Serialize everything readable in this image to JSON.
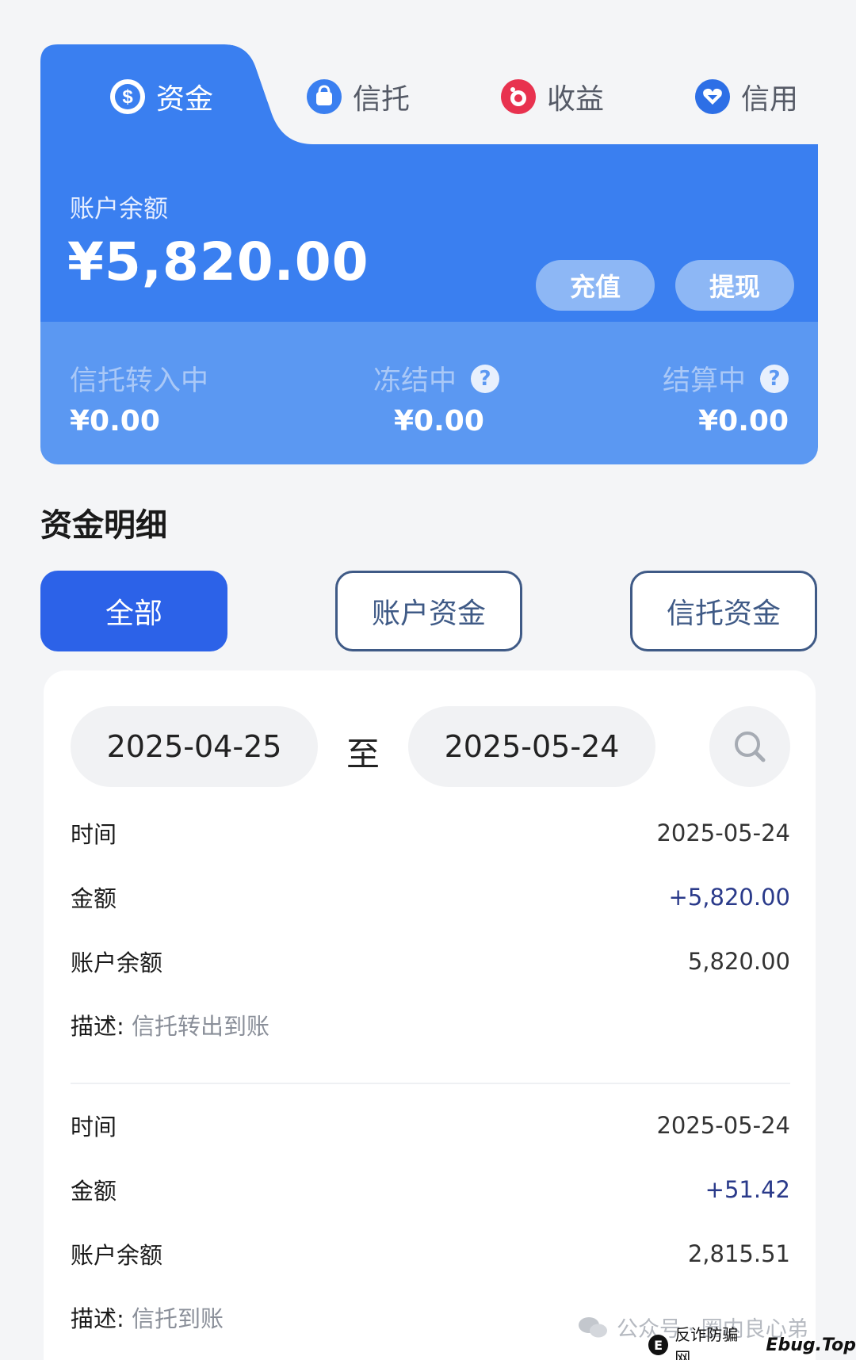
{
  "tabs": [
    {
      "label": "资金",
      "icon": "dollar-coin-icon",
      "active": true
    },
    {
      "label": "信托",
      "icon": "bag-icon",
      "active": false
    },
    {
      "label": "收益",
      "icon": "piggy-icon",
      "active": false
    },
    {
      "label": "信用",
      "icon": "heart-shield-icon",
      "active": false
    }
  ],
  "balance": {
    "label": "账户余额",
    "amount": "¥5,820.00",
    "recharge_label": "充值",
    "withdraw_label": "提现"
  },
  "stats": [
    {
      "label": "信托转入中",
      "value": "¥0.00",
      "help": false
    },
    {
      "label": "冻结中",
      "value": "¥0.00",
      "help": true
    },
    {
      "label": "结算中",
      "value": "¥0.00",
      "help": true
    }
  ],
  "help_glyph": "?",
  "section_title": "资金明细",
  "filters": {
    "all": "全部",
    "account": "账户资金",
    "trust": "信托资金"
  },
  "date_range": {
    "from": "2025-04-25",
    "separator": "至",
    "to": "2025-05-24"
  },
  "labels": {
    "time": "时间",
    "amount": "金额",
    "balance": "账户余额",
    "desc": "描述:"
  },
  "records": [
    {
      "time": "2025-05-24",
      "amount": "+5,820.00",
      "balance": "5,820.00",
      "desc": "信托转出到账"
    },
    {
      "time": "2025-05-24",
      "amount": "+51.42",
      "balance": "2,815.51",
      "desc": "信托到账"
    }
  ],
  "watermark": {
    "line1": "公众号 · 圈内良心弟",
    "line2": "反诈防骗网",
    "brand": "Ebug.Top",
    "logo": "E"
  },
  "colors": {
    "primary": "#3a7ff0",
    "accent": "#2c62e8",
    "positive": "#2a3a8a"
  }
}
